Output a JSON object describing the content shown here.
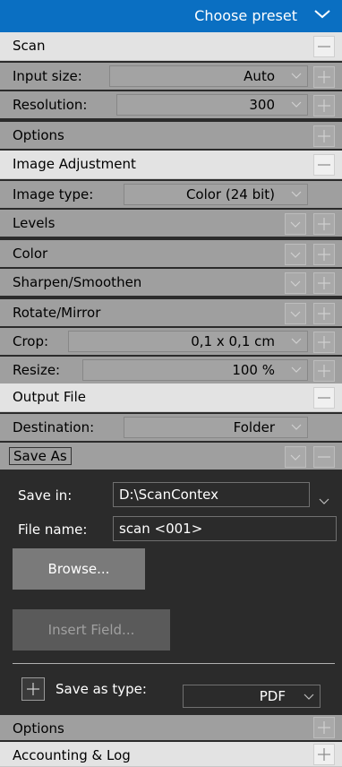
{
  "header": {
    "preset_label": "Choose preset",
    "chevron_icon": "chevron-down-icon"
  },
  "scan": {
    "title": "Scan",
    "input_size": {
      "label": "Input size:",
      "value": "Auto"
    },
    "resolution": {
      "label": "Resolution:",
      "value": "300"
    },
    "options": {
      "label": "Options"
    }
  },
  "image_adjustment": {
    "title": "Image Adjustment",
    "image_type": {
      "label": "Image type:",
      "value": "Color (24 bit)"
    },
    "levels": {
      "label": "Levels"
    },
    "color": {
      "label": "Color"
    },
    "sharpen": {
      "label": "Sharpen/Smoothen"
    },
    "rotate": {
      "label": "Rotate/Mirror"
    },
    "crop": {
      "label": "Crop:",
      "value": "0,1 x 0,1 cm"
    },
    "resize": {
      "label": "Resize:",
      "value": "100 %"
    }
  },
  "output_file": {
    "title": "Output File",
    "destination": {
      "label": "Destination:",
      "value": "Folder"
    },
    "save_as": {
      "label": "Save As",
      "save_in_label": "Save in:",
      "save_in_value": "D:\\ScanContex",
      "file_name_label": "File name:",
      "file_name_value": "scan <001>",
      "browse_label": "Browse...",
      "insert_field_label": "Insert Field...",
      "save_as_type_label": "Save as type:",
      "save_as_type_value": "PDF"
    },
    "options": {
      "label": "Options"
    }
  },
  "accounting": {
    "title": "Accounting & Log"
  },
  "colors": {
    "accent": "#0a6fc2",
    "section_bg": "#e3e3e3",
    "sub_bg": "#9f9f9f",
    "panel_bg": "#2b2b2b"
  }
}
